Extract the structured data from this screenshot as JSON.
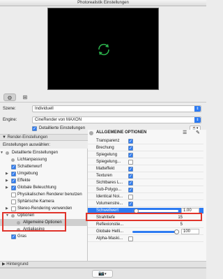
{
  "window": {
    "title": "Photorealistik Einstellungen"
  },
  "preview": {
    "icon": "refresh-icon",
    "accent": "#2bb24c"
  },
  "tabs": [
    {
      "icon": "gear-icon",
      "active": true
    },
    {
      "icon": "layout-icon",
      "active": false
    }
  ],
  "scene": {
    "label": "Szene:",
    "value": "Individuell"
  },
  "engine": {
    "label": "Engine:",
    "value": "CineRender von MAXON"
  },
  "detailed": {
    "label": "Detaillierte Einstellungen",
    "checked": true
  },
  "render_section": {
    "title": "Render-Einstellungen"
  },
  "tree_header": {
    "label": "Einstellungen auswählen:"
  },
  "tree": [
    {
      "label": "Detaillierte Einstellungen",
      "kind": "dot",
      "indent": 0,
      "arrow": "▼"
    },
    {
      "label": "Lichtanpassung",
      "kind": "dot",
      "indent": 1
    },
    {
      "label": "Schattenwurf",
      "kind": "cb",
      "indent": 1
    },
    {
      "label": "Umgebung",
      "kind": "cb",
      "indent": 1,
      "arrow": "▶"
    },
    {
      "label": "Effekte",
      "kind": "cb",
      "indent": 1,
      "arrow": "▶"
    },
    {
      "label": "Globale Beleuchtung",
      "kind": "cb",
      "indent": 1,
      "arrow": "▶"
    },
    {
      "label": "Physikalischen Renderer benutzen",
      "kind": "cboff",
      "indent": 1
    },
    {
      "label": "Sphärische Kamera",
      "kind": "cboff",
      "indent": 1
    },
    {
      "label": "Stereo-Rendering verwenden",
      "kind": "cboff",
      "indent": 1,
      "arrow": "▶"
    },
    {
      "label": "Optionen",
      "kind": "dot",
      "indent": 1,
      "arrow": "▼"
    },
    {
      "label": "Allgemeine Optionen",
      "kind": "dot",
      "indent": 2,
      "selected": true
    },
    {
      "label": "Antialiasing",
      "kind": "dot",
      "indent": 2
    },
    {
      "label": "Gras",
      "kind": "cb",
      "indent": 1
    }
  ],
  "props": {
    "header": "ALLGEMEINE OPTIONEN",
    "rows": [
      {
        "label": "Transparenz",
        "checked": true
      },
      {
        "label": "Brechung",
        "checked": true
      },
      {
        "label": "Spiegelung",
        "checked": true
      },
      {
        "label": "Spiegelung...",
        "checked": false
      },
      {
        "label": "Matteffekt",
        "checked": true
      },
      {
        "label": "Texturen",
        "checked": true
      },
      {
        "label": "Sichtbares L...",
        "checked": true
      },
      {
        "label": "Sub-Polygo...",
        "checked": true
      },
      {
        "label": "Identical Noi...",
        "checked": false
      },
      {
        "label": "Volumenstre...",
        "checked": true
      }
    ],
    "threshold": {
      "label": "Schwellwert",
      "value": "1.00",
      "level": 0.08
    },
    "beam": {
      "label": "Strahltiefe",
      "value": "15"
    },
    "reflection": {
      "label": "Reflexionstie...",
      "value": "5"
    },
    "global_light": {
      "label": "Globale Helli...",
      "value": "100",
      "level": 0.95
    },
    "alpha": {
      "label": "Alpha-Maski...",
      "checked": false
    }
  },
  "background_section": {
    "title": "Hintergrund"
  },
  "bottom": {
    "icon": "camera-icon",
    "dropdown_icon": "chevron-down-icon"
  }
}
